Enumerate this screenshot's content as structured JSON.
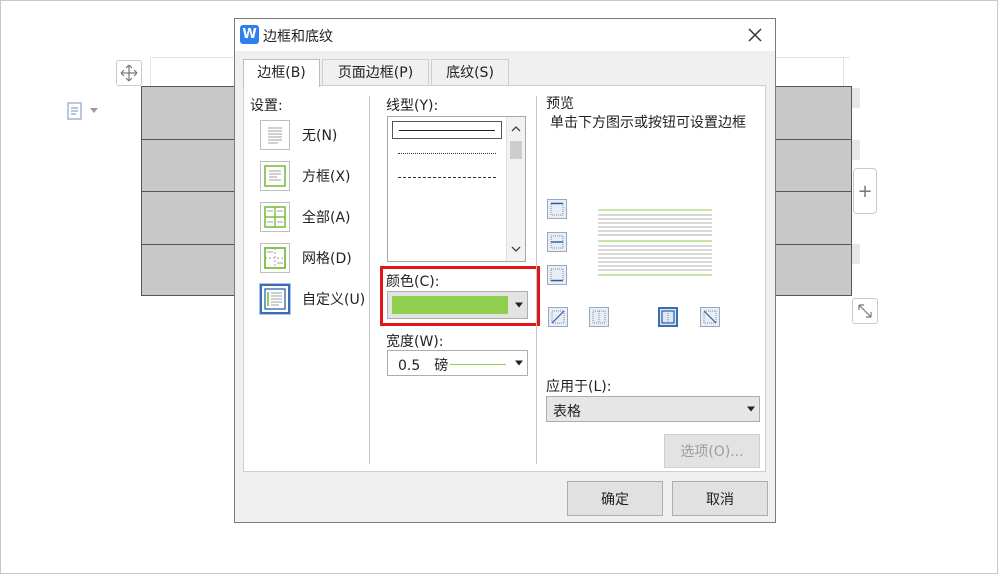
{
  "dialog": {
    "title": "边框和底纹",
    "app_icon": "W",
    "close_icon": "close-icon"
  },
  "tabs": [
    {
      "label": "边框(B)",
      "active": true
    },
    {
      "label": "页面边框(P)",
      "active": false
    },
    {
      "label": "底纹(S)",
      "active": false
    }
  ],
  "settings": {
    "heading": "设置:",
    "items": [
      {
        "label": "无(N)",
        "icon": "border-none-icon"
      },
      {
        "label": "方框(X)",
        "icon": "border-box-icon"
      },
      {
        "label": "全部(A)",
        "icon": "border-all-icon"
      },
      {
        "label": "网格(D)",
        "icon": "border-grid-icon"
      },
      {
        "label": "自定义(U)",
        "icon": "border-custom-icon",
        "selected": true
      }
    ]
  },
  "line_style": {
    "heading": "线型(Y):",
    "items": [
      "solid",
      "dotted",
      "dashed-small",
      "dashed",
      "dash-dot",
      "dash-dot-dot"
    ],
    "selected": "solid"
  },
  "color": {
    "label": "颜色(C):",
    "value_color": "#8fcf4d"
  },
  "width": {
    "label": "宽度(W):",
    "value": "0.5　磅"
  },
  "preview": {
    "heading": "预览",
    "hint": "单击下方图示或按钮可设置边框",
    "line_color": "#8fcf4d"
  },
  "apply_to": {
    "label": "应用于(L):",
    "value": "表格"
  },
  "buttons": {
    "options": "选项(O)...",
    "ok": "确定",
    "cancel": "取消"
  },
  "colors": {
    "highlight": "#e0161b",
    "accent": "#2f7ff0"
  }
}
